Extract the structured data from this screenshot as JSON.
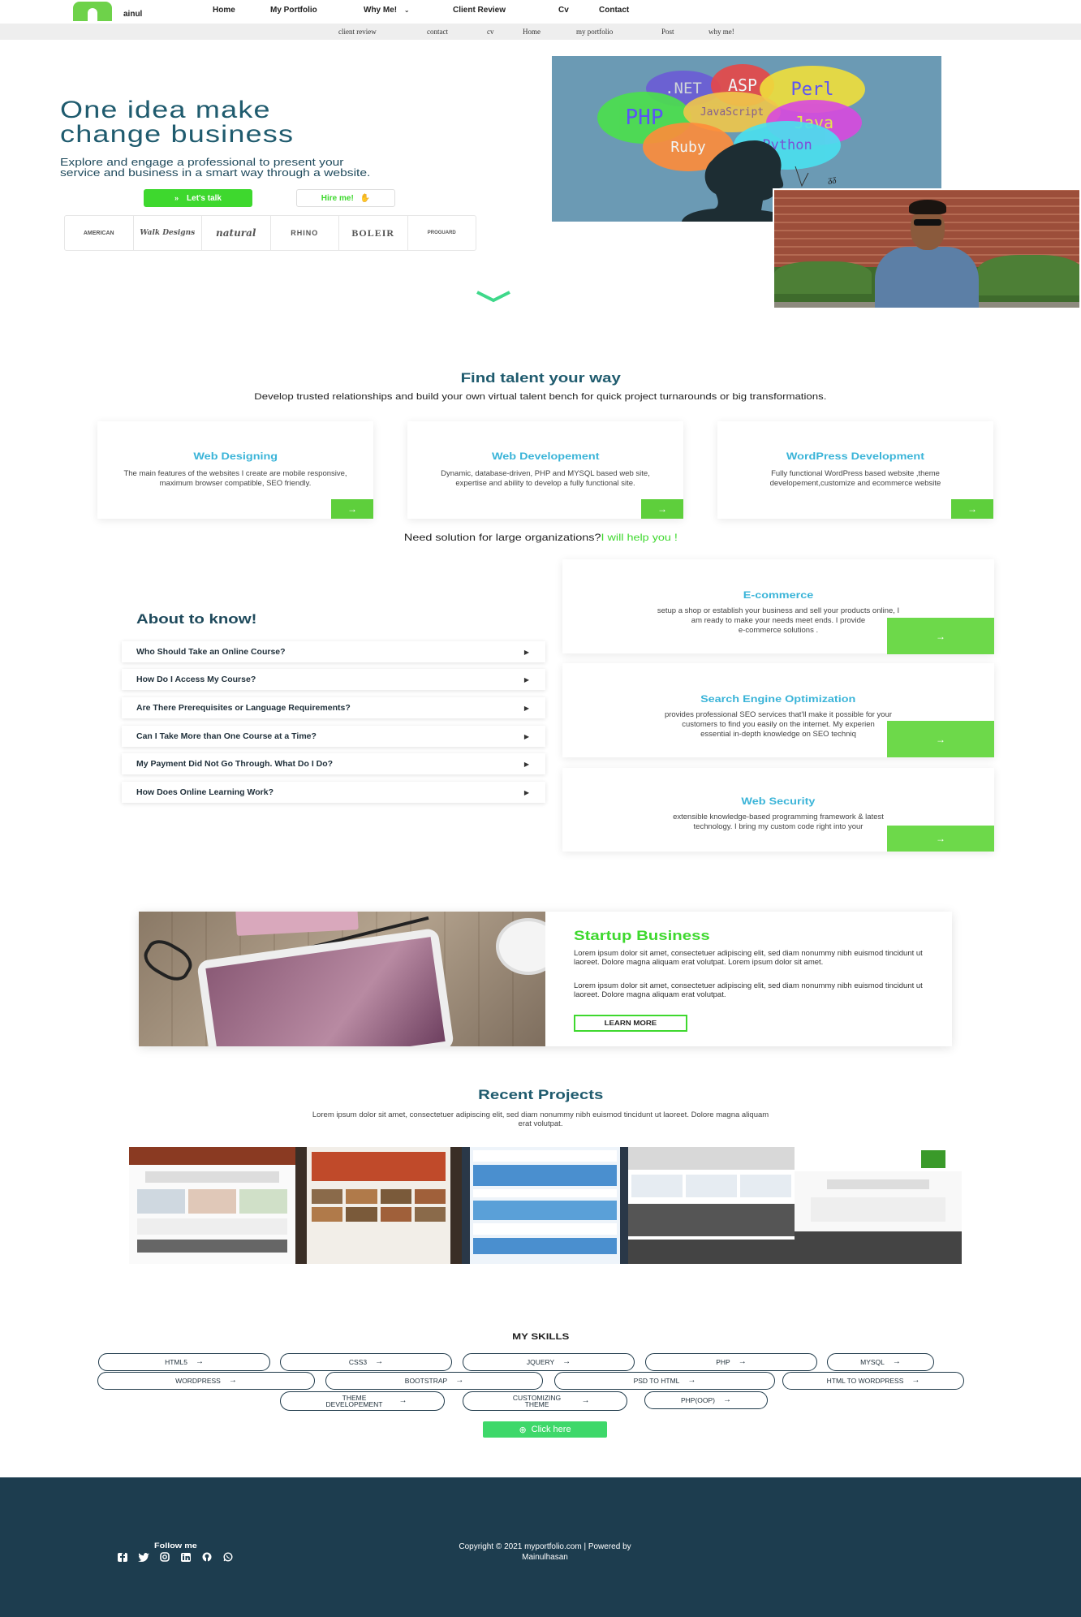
{
  "nav": {
    "logo_text": "ainul",
    "items": [
      "Home",
      "My Portfolio",
      "Why Me!",
      "Client Review",
      "Cv",
      "Contact"
    ],
    "subitems": [
      "client review",
      "contact",
      "cv",
      "Home",
      "my portfolio",
      "Post",
      "why me!"
    ]
  },
  "hero": {
    "title_line1": "One idea make",
    "title_line2": "change business",
    "desc_line1": "Explore and engage a professional to present your",
    "desc_line2": "service and business in a smart way through a website.",
    "btn_talk": "Let's talk",
    "btn_hire": "Hire me!",
    "brands": [
      "AMERICAN",
      "Walk Designs",
      "natural",
      "RHINO",
      "BOLEIR",
      "PROGUARD"
    ],
    "image_words": [
      ".NET",
      "ASP",
      "Perl",
      "PHP",
      "JavaScript",
      "Java",
      "Ruby",
      "Python"
    ]
  },
  "talent": {
    "title": "Find talent your way",
    "desc": "Develop trusted relationships and build your own virtual talent bench for quick project turnarounds or big transformations.",
    "cards": [
      {
        "title": "Web Designing",
        "desc": "The main features of the websites I create are mobile responsive, maximum browser compatible, SEO friendly."
      },
      {
        "title": "Web Developement",
        "desc": "Dynamic, database-driven, PHP and MYSQL based web site, expertise and ability to develop a fully functional site."
      },
      {
        "title": "WordPress Development",
        "desc": "Fully functional WordPress based website ,theme developement,customize and ecommerce website"
      }
    ],
    "need_text": "Need solution for large organizations?",
    "need_highlight": "I will help you !"
  },
  "about": {
    "title": "About to know!",
    "faqs": [
      "Who Should Take an Online Course?",
      "How Do I Access My Course?",
      "Are There Prerequisites or Language Requirements?",
      "Can I Take More than One Course at a Time?",
      "My Payment Did Not Go Through. What Do I Do?",
      "How Does Online Learning Work?"
    ]
  },
  "services": [
    {
      "title": "E-commerce",
      "line1": "setup a shop or establish your business and sell your products online, I",
      "line2": "am ready to make your needs meet ends. I provide",
      "line3": "e-commerce solutions ."
    },
    {
      "title": "Search Engine Optimization",
      "line1": "provides professional SEO services that'll make it possible for your",
      "line2": "customers to find you easily on the internet. My experien",
      "line3": "essential in-depth knowledge on SEO techniq"
    },
    {
      "title": "Web Security",
      "line1": "extensible knowledge-based programming framework & latest",
      "line2": "technology. I bring my custom code right into your",
      "line3": ""
    }
  ],
  "startup": {
    "title": "Startup Business",
    "p1": "Lorem ipsum dolor sit amet, consectetuer adipiscing elit, sed diam nonummy nibh euismod tincidunt ut laoreet. Dolore magna aliquam erat volutpat. Lorem ipsum dolor sit amet.",
    "p2": "Lorem ipsum dolor sit amet, consectetuer adipiscing elit, sed diam nonummy nibh euismod tincidunt ut laoreet. Dolore magna aliquam erat volutpat.",
    "learn_more": "LEARN MORE"
  },
  "projects": {
    "title": "Recent Projects",
    "desc": "Lorem ipsum dolor sit amet, consectetuer adipiscing elit, sed diam nonummy nibh euismod tincidunt ut laoreet. Dolore magna aliquam erat volutpat."
  },
  "skills": {
    "title": "MY SKILLS",
    "row1": [
      "HTML5",
      "CSS3",
      "JQUERY",
      "PHP",
      "MYSQL"
    ],
    "row2": [
      "WORDPRESS",
      "BOOTSTRAP",
      "PSD TO HTML",
      "HTML TO WORDPRESS"
    ],
    "row3": [
      "THEME DEVELOPEMENT",
      "CUSTOMIZING THEME",
      "PHP(OOP)"
    ],
    "click_here": "Click here"
  },
  "footer": {
    "follow": "Follow me",
    "social_icons": [
      "facebook-icon",
      "twitter-icon",
      "instagram-icon",
      "linkedin-icon",
      "github-icon",
      "whatsapp-icon"
    ],
    "copyright_line1": "Copyright © 2021 myportfolio.com | Powered by",
    "copyright_line2": "Mainulhasan"
  },
  "colors": {
    "accent": "#3ed82e",
    "heading": "#1f5b6e",
    "link": "#3ab4d8",
    "footer": "#1d3d4f"
  }
}
